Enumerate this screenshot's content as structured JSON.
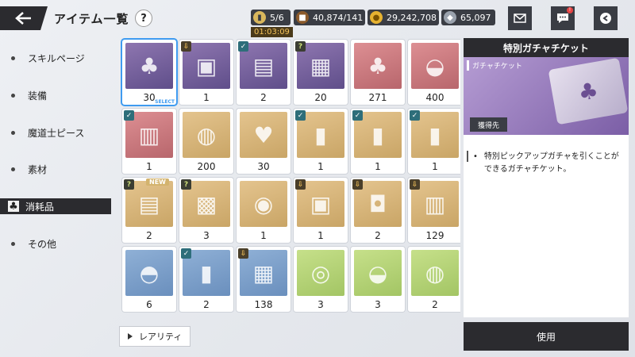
{
  "header": {
    "title": "アイテム一覧",
    "help_label": "?"
  },
  "resources": {
    "stamina": "5/6",
    "timer": "01:03:09",
    "storage": "40,874/141",
    "gold": "29,242,708",
    "crystal": "65,097"
  },
  "sidebar": {
    "items": [
      {
        "label": "スキルページ"
      },
      {
        "label": "装備"
      },
      {
        "label": "魔道士ピース"
      },
      {
        "label": "素材"
      },
      {
        "label": "消耗品"
      },
      {
        "label": "その他"
      }
    ],
    "active_index": 4
  },
  "grid": {
    "items": [
      {
        "count": "30",
        "bg": "purple",
        "icon": "ticket-icon",
        "mark": "",
        "selected": true
      },
      {
        "count": "1",
        "bg": "purple",
        "icon": "briefcase-icon",
        "mark": "down"
      },
      {
        "count": "2",
        "bg": "purple",
        "icon": "treasure-chest-icon",
        "mark": "check"
      },
      {
        "count": "20",
        "bg": "purple",
        "icon": "black-chest-icon",
        "mark": "q"
      },
      {
        "count": "271",
        "bg": "pink",
        "icon": "ticket-icon",
        "mark": ""
      },
      {
        "count": "400",
        "bg": "pink",
        "icon": "grilled-fish-icon",
        "mark": ""
      },
      {
        "count": "1",
        "bg": "pink",
        "icon": "metal-chest-icon",
        "mark": "check"
      },
      {
        "count": "200",
        "bg": "gold",
        "icon": "lobster-plate-icon",
        "mark": ""
      },
      {
        "count": "30",
        "bg": "gold",
        "icon": "cupcake-icon",
        "mark": ""
      },
      {
        "count": "1",
        "bg": "gold",
        "icon": "card-icon",
        "mark": "check"
      },
      {
        "count": "1",
        "bg": "gold",
        "icon": "card-icon",
        "mark": "check"
      },
      {
        "count": "1",
        "bg": "gold",
        "icon": "card-icon",
        "mark": "check"
      },
      {
        "count": "2",
        "bg": "gold",
        "icon": "red-chest-icon",
        "mark": "q",
        "new": true
      },
      {
        "count": "3",
        "bg": "gold",
        "icon": "gift-box-icon",
        "mark": "q"
      },
      {
        "count": "1",
        "bg": "gold",
        "icon": "blue-lantern-icon",
        "mark": ""
      },
      {
        "count": "1",
        "bg": "gold",
        "icon": "gold-chest-icon",
        "mark": "down"
      },
      {
        "count": "2",
        "bg": "gold",
        "icon": "red-drum-box-icon",
        "mark": "down"
      },
      {
        "count": "129",
        "bg": "gold",
        "icon": "wooden-chest-icon",
        "mark": "down"
      },
      {
        "count": "6",
        "bg": "blue",
        "icon": "sandwich-icon",
        "mark": ""
      },
      {
        "count": "2",
        "bg": "blue",
        "icon": "card-icon",
        "mark": "check"
      },
      {
        "count": "138",
        "bg": "blue",
        "icon": "silver-chest-icon",
        "mark": "down"
      },
      {
        "count": "3",
        "bg": "green",
        "icon": "salad-plate-icon",
        "mark": ""
      },
      {
        "count": "3",
        "bg": "green",
        "icon": "fish-plate-icon",
        "mark": ""
      },
      {
        "count": "2",
        "bg": "green",
        "icon": "meat-plate-icon",
        "mark": ""
      }
    ],
    "select_tag": "SELECT",
    "new_tag": "NEW"
  },
  "rarity_button": {
    "label": "レアリティ"
  },
  "detail": {
    "title": "特別ガチャチケット",
    "item_name": "ガチャチケット",
    "obtain_label": "獲得先",
    "description": "特別ピックアップガチャを引くことができるガチャチケット。"
  },
  "use_button": {
    "label": "使用"
  },
  "colors": {
    "dark": "#2b2b2f",
    "select_blue": "#3f9bf0",
    "accent_gold": "#f2c15a"
  }
}
